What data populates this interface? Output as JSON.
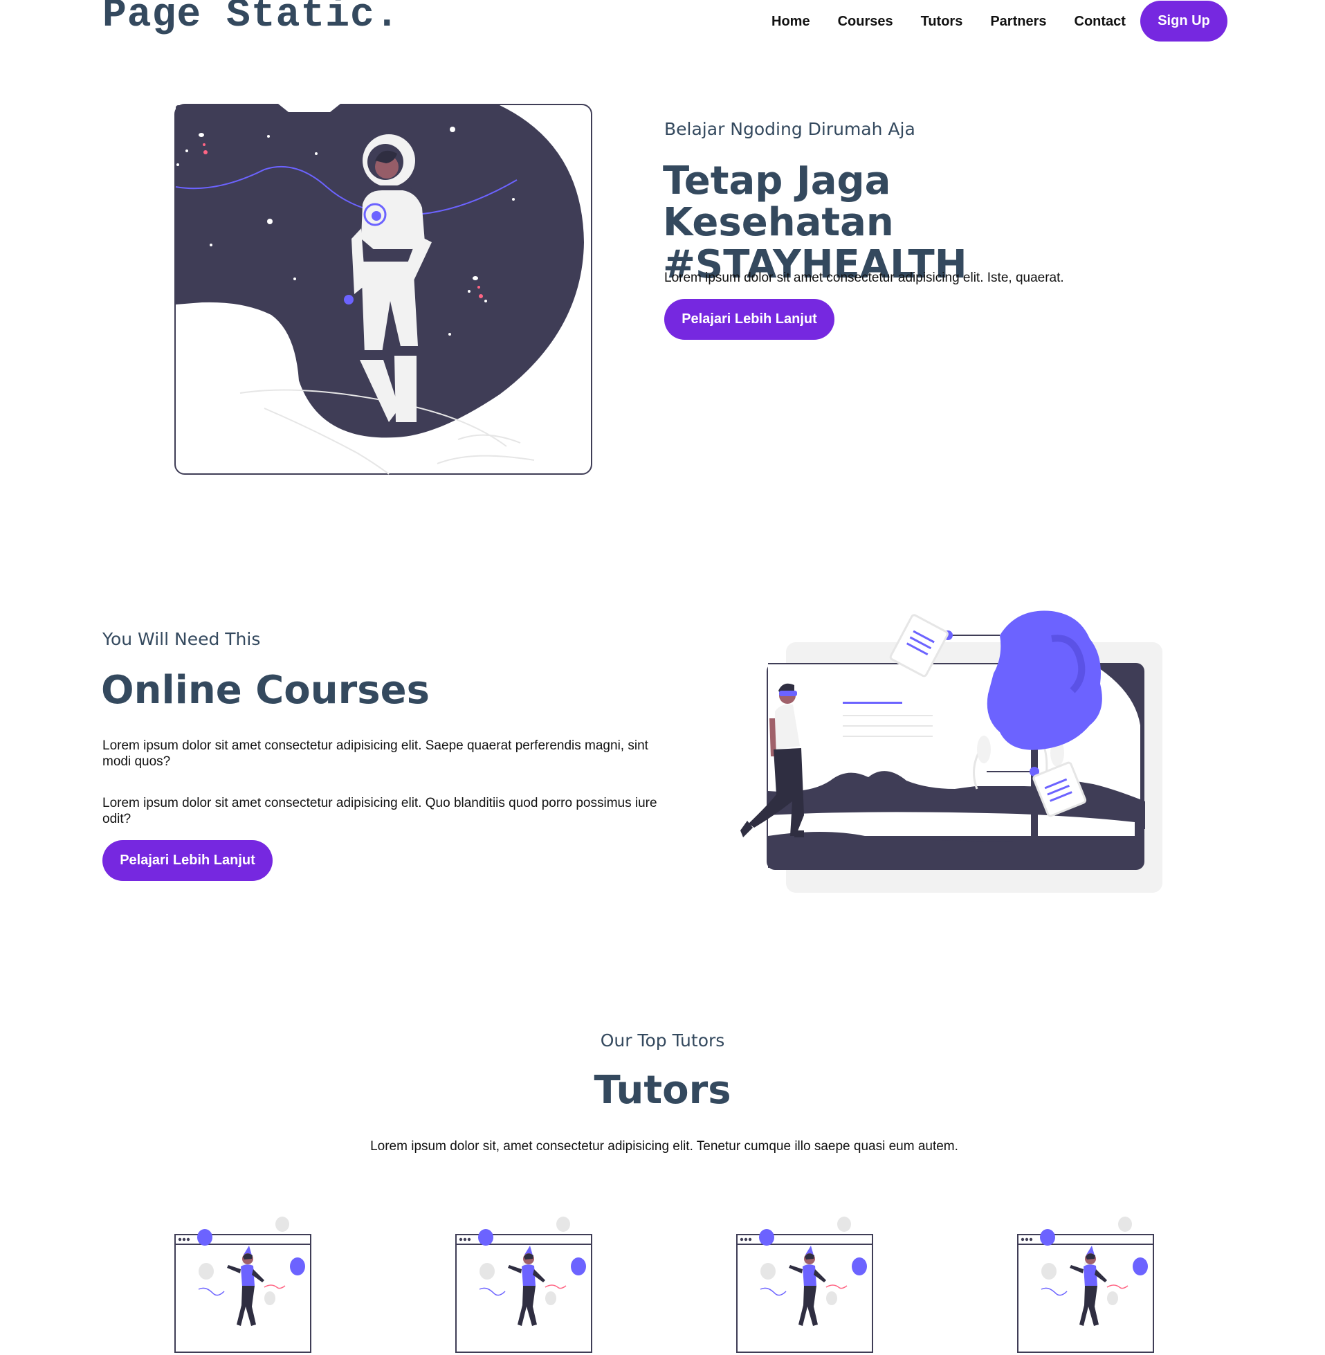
{
  "header": {
    "logo": "Page Static.",
    "nav": [
      "Home",
      "Courses",
      "Tutors",
      "Partners",
      "Contact"
    ],
    "signup": "Sign Up"
  },
  "hero": {
    "kicker": "Belajar Ngoding Dirumah Aja",
    "title": "Tetap Jaga Kesehatan #STAYHEALTH",
    "text": "Lorem ipsum dolor sit amet consectetur adipisicing elit. Iste, quaerat.",
    "button": "Pelajari Lebih Lanjut"
  },
  "courses": {
    "kicker": "You Will Need This",
    "title": "Online Courses",
    "text1": "Lorem ipsum dolor sit amet consectetur adipisicing elit. Saepe quaerat perferendis magni, sint modi quos?",
    "text2": "Lorem ipsum dolor sit amet consectetur adipisicing elit. Quo blanditiis quod porro possimus iure odit?",
    "button": "Pelajari Lebih Lanjut"
  },
  "tutors": {
    "kicker": "Our Top Tutors",
    "title": "Tutors",
    "text": "Lorem ipsum dolor sit, amet consectetur adipisicing elit. Tenetur cumque illo saepe quasi eum autem."
  },
  "colors": {
    "accent": "#7628e0",
    "heading": "#34495e",
    "illustration_dark": "#3f3d56",
    "illustration_purple": "#6c63ff"
  }
}
